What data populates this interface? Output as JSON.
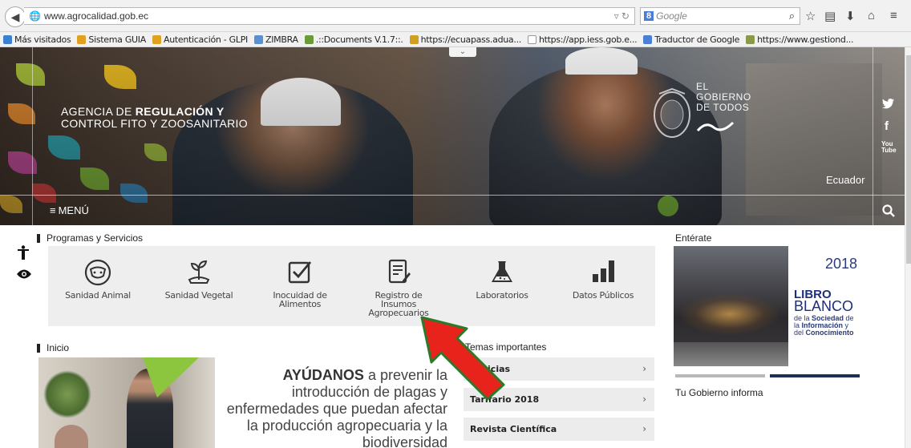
{
  "browser": {
    "url": "www.agrocalidad.gob.ec",
    "search_engine_badge": "8",
    "search_placeholder": "Google",
    "bookmarks": [
      {
        "label": "Más visitados",
        "color": "#3d7fd0"
      },
      {
        "label": "Sistema GUIA",
        "color": "#e0a020"
      },
      {
        "label": "Autenticación - GLPI",
        "color": "#e0a020"
      },
      {
        "label": "ZIMBRA",
        "color": "#5a8fd0"
      },
      {
        "label": ".::Documents V.1.7::.",
        "color": "#6a9a3a"
      },
      {
        "label": "https://ecuapass.adua...",
        "color": "#d0a020"
      },
      {
        "label": "https://app.iess.gob.e...",
        "color": "#ffffff"
      },
      {
        "label": "Traductor de Google",
        "color": "#4a7fd6"
      },
      {
        "label": "https://www.gestiond...",
        "color": "#8a9a4a"
      }
    ]
  },
  "hero": {
    "dropdown_glyph": "⌄",
    "agency_line1_light": "AGENCIA DE ",
    "agency_line1_bold": "REGULACIÓN Y",
    "agency_line2": "CONTROL FITO Y ZOOSANITARIO",
    "gov_line1": "EL",
    "gov_line2": "GOBIERNO",
    "gov_line3": "DE TODOS",
    "country": "Ecuador",
    "menu_label": "MENÚ",
    "social": {
      "twitter": "🐦",
      "facebook": "f",
      "youtube": "You Tube"
    }
  },
  "programas": {
    "title": "Programas y Servicios",
    "items": [
      {
        "label": "Sanidad Animal",
        "icon": "cow-icon"
      },
      {
        "label": "Sanidad Vegetal",
        "icon": "plant-icon"
      },
      {
        "label": "Inocuidad de Alimentos",
        "icon": "checkbox-icon"
      },
      {
        "label": "Registro de Insumos Agropecuarios",
        "icon": "document-pen-icon"
      },
      {
        "label": "Laboratorios",
        "icon": "flask-icon"
      },
      {
        "label": "Datos Públicos",
        "icon": "bar-chart-icon"
      }
    ]
  },
  "inicio": {
    "title": "Inicio",
    "campaign_bold": "AYÚDANOS",
    "campaign_rest": " a prevenir la introducción de plagas y enfermedades que puedan afectar la producción agropecuaria y la biodiversidad"
  },
  "temas": {
    "title": "Temas importantes",
    "items": [
      {
        "label": "Noticias"
      },
      {
        "label": "Tarifario 2018"
      },
      {
        "label": "Revista Científica"
      }
    ]
  },
  "enterate": {
    "title": "Entérate",
    "year": "2018",
    "libro_line1": "LIBRO",
    "libro_line2": "BLANCO",
    "libro_small1": "de la ",
    "libro_small1_b": "Sociedad",
    "libro_small1_end": " de",
    "libro_small2": "la ",
    "libro_small2_b": "Información",
    "libro_small2_end": " y",
    "libro_small3": "del ",
    "libro_small3_b": "Conocimiento",
    "gob_informa": "Tu Gobierno informa"
  },
  "colors": {
    "accent_red": "#e8231c",
    "navy": "#1e2f7a",
    "panel_gray": "#eeeeee"
  }
}
